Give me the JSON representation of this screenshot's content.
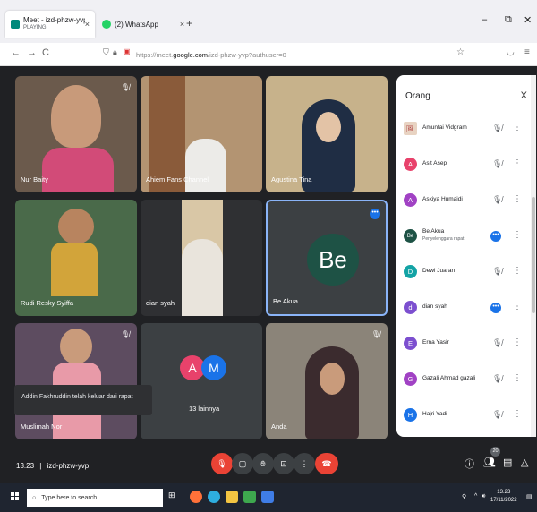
{
  "browser": {
    "tabs": [
      {
        "title": "Meet - izd-phzw-yvp",
        "subtitle": "PLAYING",
        "close": "×"
      },
      {
        "title": "(2) WhatsApp",
        "close": "×"
      }
    ],
    "new_tab": "+",
    "window_controls": {
      "minimize": "–",
      "restore": "⧉",
      "close": "✕"
    },
    "nav": {
      "back": "←",
      "forward": "→",
      "reload": "C"
    },
    "url": {
      "scheme": "https://meet.",
      "host": "google.com",
      "path": "/izd-phzw-yvp?authuser=0"
    }
  },
  "tiles": [
    {
      "name": "Nur Baity",
      "muted": true
    },
    {
      "name": "Ahiem Fans Channel",
      "muted": false
    },
    {
      "name": "Agustina Tina",
      "muted": false
    },
    {
      "name": "Rudi Resky Syiffa",
      "muted": false
    },
    {
      "name": "dian syah",
      "muted": false
    },
    {
      "name": "Be Akua",
      "avatar_text": "Be",
      "more": "•••"
    },
    {
      "name": "Muslimah Nor",
      "muted": true
    },
    {
      "name": "13 lainnya",
      "avatar_a": "A",
      "avatar_m": "M"
    },
    {
      "name": "Anda",
      "muted": true
    }
  ],
  "toast": "Addin Fakhruddin telah keluar dari rapat",
  "meeting": {
    "time": "13.23",
    "separator": "|",
    "code": "izd-phzw-yvp"
  },
  "participant_count": "20",
  "panel": {
    "title": "Orang",
    "close": "X",
    "people": [
      {
        "initial": "🖼",
        "name": "Amuntai Vidgram",
        "subtitle": "",
        "color": "#e8d3c2",
        "speaking": false
      },
      {
        "initial": "A",
        "name": "Asit Asep",
        "subtitle": "",
        "color": "#e8426b",
        "speaking": false
      },
      {
        "initial": "A",
        "name": "Askiya Humaidi",
        "subtitle": "",
        "color": "#a142c4",
        "speaking": false
      },
      {
        "initial": "Be",
        "name": "Be Akua",
        "subtitle": "Penyelenggara rapat",
        "color": "#1e5245",
        "speaking": true
      },
      {
        "initial": "D",
        "name": "Dewi Juaran",
        "subtitle": "",
        "color": "#13a3a5",
        "speaking": false
      },
      {
        "initial": "d",
        "name": "dian syah",
        "subtitle": "",
        "color": "#7c4fcf",
        "speaking": true
      },
      {
        "initial": "E",
        "name": "Erna Yasir",
        "subtitle": "",
        "color": "#7c4fcf",
        "speaking": false
      },
      {
        "initial": "G",
        "name": "Gazali Ahmad gazali",
        "subtitle": "",
        "color": "#a142c4",
        "speaking": false
      },
      {
        "initial": "H",
        "name": "Hajri Yadi",
        "subtitle": "",
        "color": "#1a73e8",
        "speaking": false
      }
    ]
  },
  "taskbar": {
    "search_placeholder": "Type here to search",
    "clock_time": "13.23",
    "clock_date": "17/11/2022"
  }
}
